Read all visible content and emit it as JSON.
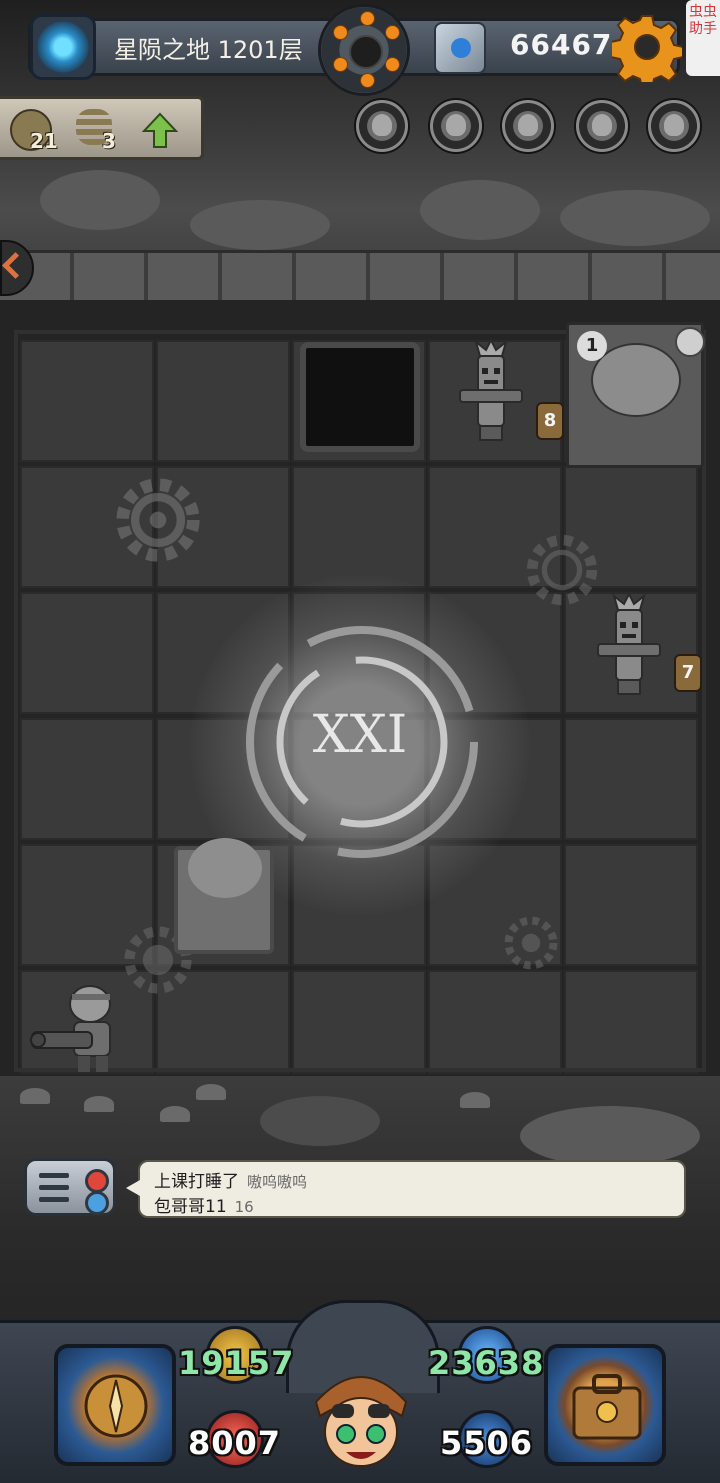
{
  "header": {
    "level_title": "星陨之地 1201层",
    "currency_value": "66467",
    "helper_label": "虫虫助手"
  },
  "resources": {
    "keys_count": "21",
    "springs_count": "3"
  },
  "top_slots": [
    "slot-1",
    "slot-2",
    "slot-3",
    "slot-4",
    "slot-5"
  ],
  "board": {
    "floor_numeral": "XXI",
    "totem_top_counter": "8",
    "totem_right_counter": "7",
    "unknown_monster_label": "???",
    "boss_level": "1"
  },
  "chat": {
    "line1_text": "上课打睡了",
    "line1_meta": "嗷呜嗷呜",
    "line2_text": "包哥哥11",
    "line2_meta": "16"
  },
  "hud": {
    "attack": "19157",
    "defense": "23638",
    "hp": "8007",
    "gold": "5506"
  },
  "colors": {
    "stat_green": "#8ee6a8",
    "gear_orange": "#e8941c",
    "portal_blue": "#2a8cc8"
  },
  "icons": [
    "portal-icon",
    "bomb-wheel-icon",
    "currency-icon",
    "gear-icon",
    "key-icon",
    "spring-icon",
    "up-arrow-icon",
    "chat-icon",
    "sword-icon",
    "bag-icon"
  ]
}
